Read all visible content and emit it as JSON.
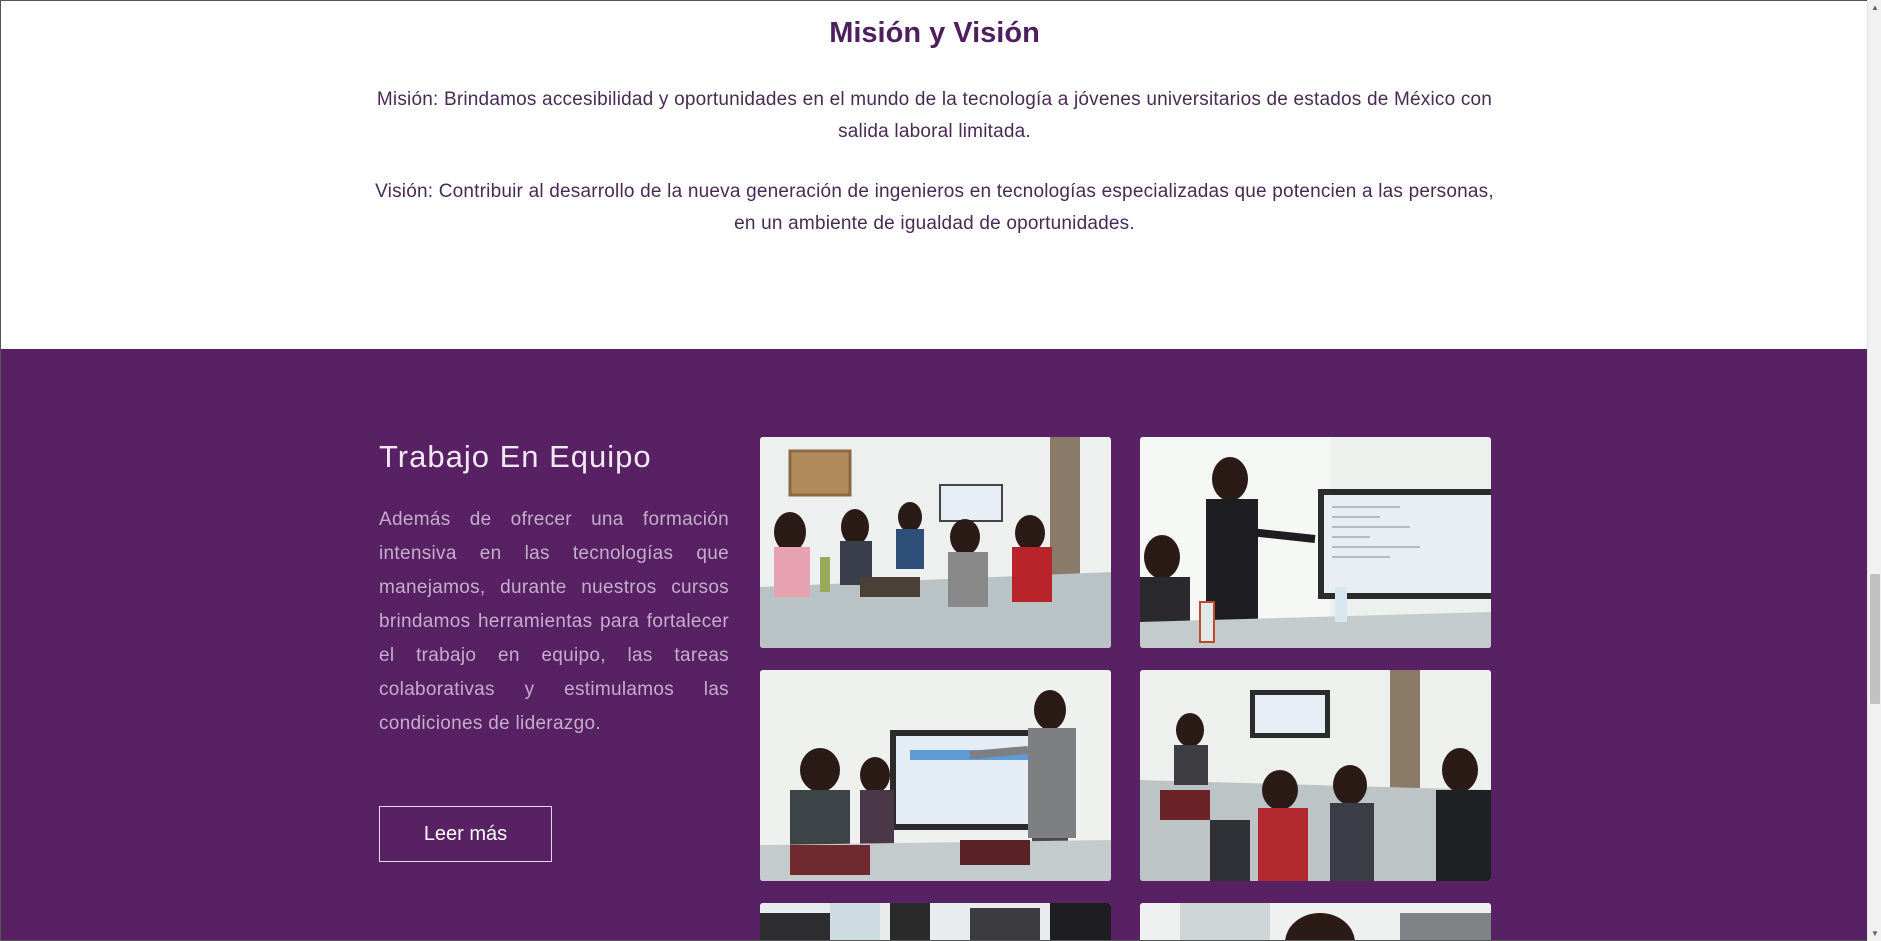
{
  "mision": {
    "title": "Misión y Visión",
    "mision_text": "Misión: Brindamos accesibilidad y oportunidades en el mundo de la tecnología a jóvenes universitarios de estados de México con salida laboral limitada.",
    "vision_text": "Visión: Contribuir al desarrollo de la nueva generación de ingenieros en tecnologías especializadas que potencien a las personas, en un ambiente de igualdad de oportunidades."
  },
  "team": {
    "title": "Trabajo En Equipo",
    "description": "Además de ofrecer una formación intensiva en las tecnologías que manejamos, durante nuestros cursos brindamos herramientas para fortalecer el trabajo en equipo, las tareas colaborativas y estimulamos las condiciones de liderazgo.",
    "button_label": "Leer más"
  },
  "colors": {
    "brand_purple": "#572163",
    "title_purple": "#4d1f5e"
  },
  "scrollbar": {
    "up_icon": "triangle-up-icon",
    "down_icon": "triangle-down-icon"
  }
}
